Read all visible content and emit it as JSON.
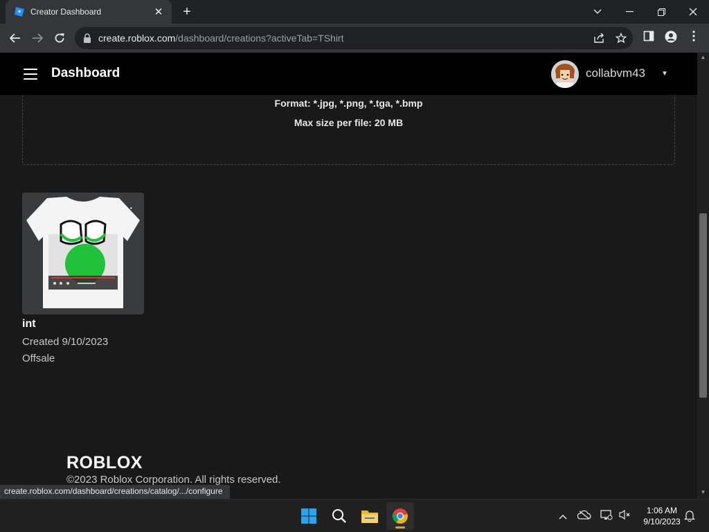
{
  "browser": {
    "tab_title": "Creator Dashboard",
    "url_host": "create.roblox.com",
    "url_path": "/dashboard/creations?activeTab=TShirt",
    "status_url": "create.roblox.com/dashboard/creations/catalog/.../configure"
  },
  "header": {
    "title": "Dashboard",
    "username": "collabvm43"
  },
  "upload": {
    "format_line": "Format: *.jpg, *.png, *.tga, *.bmp",
    "max_size_line": "Max size per file: 20 MB"
  },
  "creations": [
    {
      "name": "int",
      "created": "Created 9/10/2023",
      "status": "Offsale"
    }
  ],
  "footer": {
    "logo": "ROBLOX",
    "copyright": "©2023 Roblox Corporation. All rights reserved."
  },
  "taskbar": {
    "time": "1:06 AM",
    "date": "9/10/2023"
  },
  "colors": {
    "header_bg": "#000000",
    "page_bg": "#191919",
    "shirt_accent": "#1fc23a"
  }
}
